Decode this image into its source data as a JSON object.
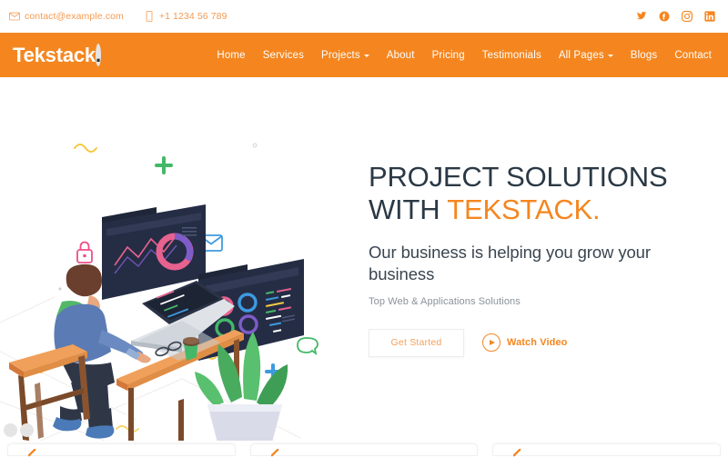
{
  "topbar": {
    "email": "contact@example.com",
    "phone": "+1 1234 56 789",
    "email_icon": "envelope-icon",
    "phone_icon": "mobile-phone-icon",
    "socials": [
      {
        "name": "twitter-icon",
        "label": "Twitter"
      },
      {
        "name": "facebook-icon",
        "label": "Facebook"
      },
      {
        "name": "instagram-icon",
        "label": "Instagram"
      },
      {
        "name": "linkedin-icon",
        "label": "LinkedIn"
      }
    ]
  },
  "nav": {
    "logo": "Tekstack",
    "logo_dot": ".",
    "items": [
      {
        "label": "Home",
        "dropdown": false
      },
      {
        "label": "Services",
        "dropdown": false
      },
      {
        "label": "Projects",
        "dropdown": true
      },
      {
        "label": "About",
        "dropdown": false
      },
      {
        "label": "Pricing",
        "dropdown": false
      },
      {
        "label": "Testimonials",
        "dropdown": false
      },
      {
        "label": "All Pages",
        "dropdown": true
      },
      {
        "label": "Blogs",
        "dropdown": false
      },
      {
        "label": "Contact",
        "dropdown": false
      }
    ]
  },
  "hero": {
    "title_line1": "PROJECT SOLUTIONS",
    "title_line2_prefix": "WITH ",
    "title_line2_accent": "TEKSTACK.",
    "subtitle": "Our business is helping you grow your business",
    "tagline": "Top Web & Applications Solutions",
    "primary_button": "Get Started",
    "video_button": "Watch Video",
    "slider_dots": 2
  },
  "colors": {
    "brand_orange": "#f5861f",
    "heading_dark": "#2b3945",
    "topbar_text": "#f59a52",
    "muted": "#8a9299",
    "monitor_navy": "#252d45"
  }
}
